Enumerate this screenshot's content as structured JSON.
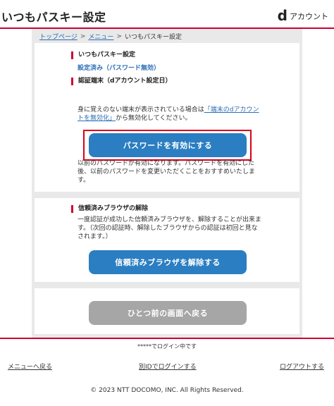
{
  "header": {
    "title": "いつもパスキー設定",
    "brand_mark": "d",
    "brand_label": "アカウント"
  },
  "breadcrumb": {
    "items": [
      "トップページ",
      "メニュー",
      "いつもパスキー設定"
    ],
    "separator": ">"
  },
  "passkey_section": {
    "heading": "いつもパスキー設定",
    "status": "設定済み（パスワード無効）"
  },
  "device_section": {
    "heading": "認証端末（dアカウント設定日）"
  },
  "notice": {
    "prefix": "身に覚えのない端末が表示されている場合は",
    "link": "「端末のdアカウントを無効化」",
    "suffix": "から無効化してください。"
  },
  "enable_password_button": "パスワードを有効にする",
  "enable_note": "以前のパスワードが有効になります。パスワードを有効にした後、以前のパスワードを変更いただくことをおすすめいたします。",
  "trusted_browser": {
    "heading": "信頼済みブラウザの解除",
    "description": "一度認証が成功した信頼済みブラウザを、解除することが出来ます。（次回の認証時、解除したブラウザからの認証は初回と見なされます。）",
    "button": "信頼済みブラウザを解除する"
  },
  "back_button": "ひとつ前の画面へ戻る",
  "footer": {
    "login_status": "*****でログイン中です",
    "menu_link": "メニューへ戻る",
    "other_id_link": "別IDでログインする",
    "logout_link": "ログアウトする",
    "copyright": "© 2023 NTT DOCOMO, INC. All Rights Reserved."
  },
  "colors": {
    "accent_red": "#cc0033",
    "button_blue": "#2b7ec1",
    "button_gray": "#a6a6a6",
    "link_blue": "#2c6eb5"
  }
}
